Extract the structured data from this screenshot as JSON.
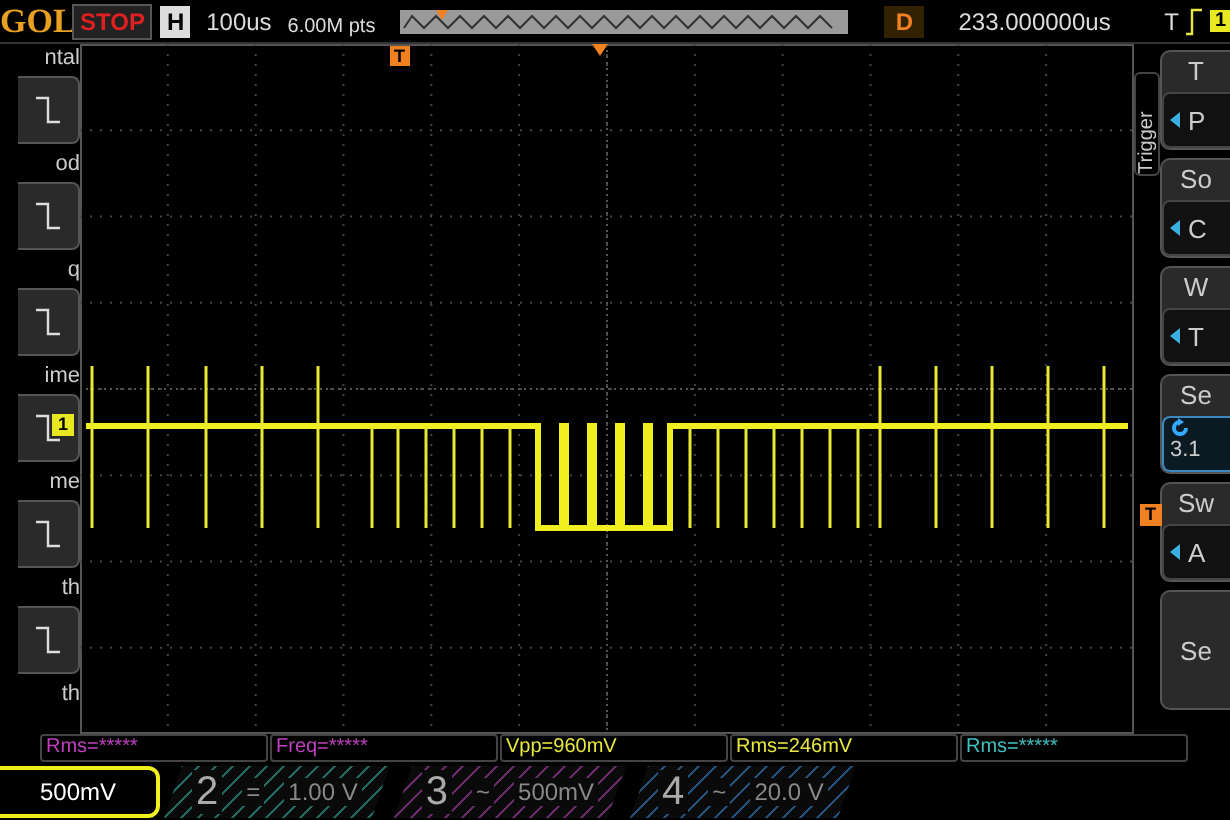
{
  "top_bar": {
    "logo": "GOL",
    "run_state": "STOP",
    "timebase_label": "H",
    "timebase": "100us",
    "memory_depth": "6.00M pts",
    "delay_label": "D",
    "delay": "233.000000us",
    "trigger_label": "T",
    "trigger_channel": "1"
  },
  "left_menu": {
    "title": "ntal",
    "items": [
      {
        "label": "od"
      },
      {
        "label": "q"
      },
      {
        "label": "ime"
      },
      {
        "label": "me"
      },
      {
        "label": "th"
      },
      {
        "label": "th"
      }
    ]
  },
  "display": {
    "channel_marker": "1",
    "trigger_marker": "T",
    "trigger_position_marker": "T"
  },
  "right_menu": {
    "tab": "Trigger",
    "items": [
      {
        "kind": "select",
        "title": "T",
        "value": "P"
      },
      {
        "kind": "select",
        "title": "So",
        "value": "C"
      },
      {
        "kind": "select",
        "title": "W",
        "value": "T"
      },
      {
        "kind": "knob",
        "title": "Se",
        "value": "3.1"
      },
      {
        "kind": "select",
        "title": "Sw",
        "value": "A"
      },
      {
        "kind": "button",
        "title": "Se"
      }
    ]
  },
  "measurements": [
    {
      "text": "Rms=*****",
      "color": "#c040c0"
    },
    {
      "text": "Freq=*****",
      "color": "#c040c0"
    },
    {
      "text": "Vpp=960mV",
      "color": "#e8e840"
    },
    {
      "text": "Rms=246mV",
      "color": "#e8e840"
    },
    {
      "text": "Rms=*****",
      "color": "#40c0c0"
    }
  ],
  "channels": [
    {
      "scale": "500mV",
      "active": true,
      "color": "#f0f020"
    },
    {
      "number": "2",
      "coupling": "=",
      "scale": "1.00 V",
      "active": false,
      "color": "#1f6a60"
    },
    {
      "number": "3",
      "coupling": "~",
      "scale": "500mV",
      "active": false,
      "color": "#6a2a6a"
    },
    {
      "number": "4",
      "coupling": "~",
      "scale": "20.0 V",
      "active": false,
      "color": "#25507a"
    }
  ]
}
